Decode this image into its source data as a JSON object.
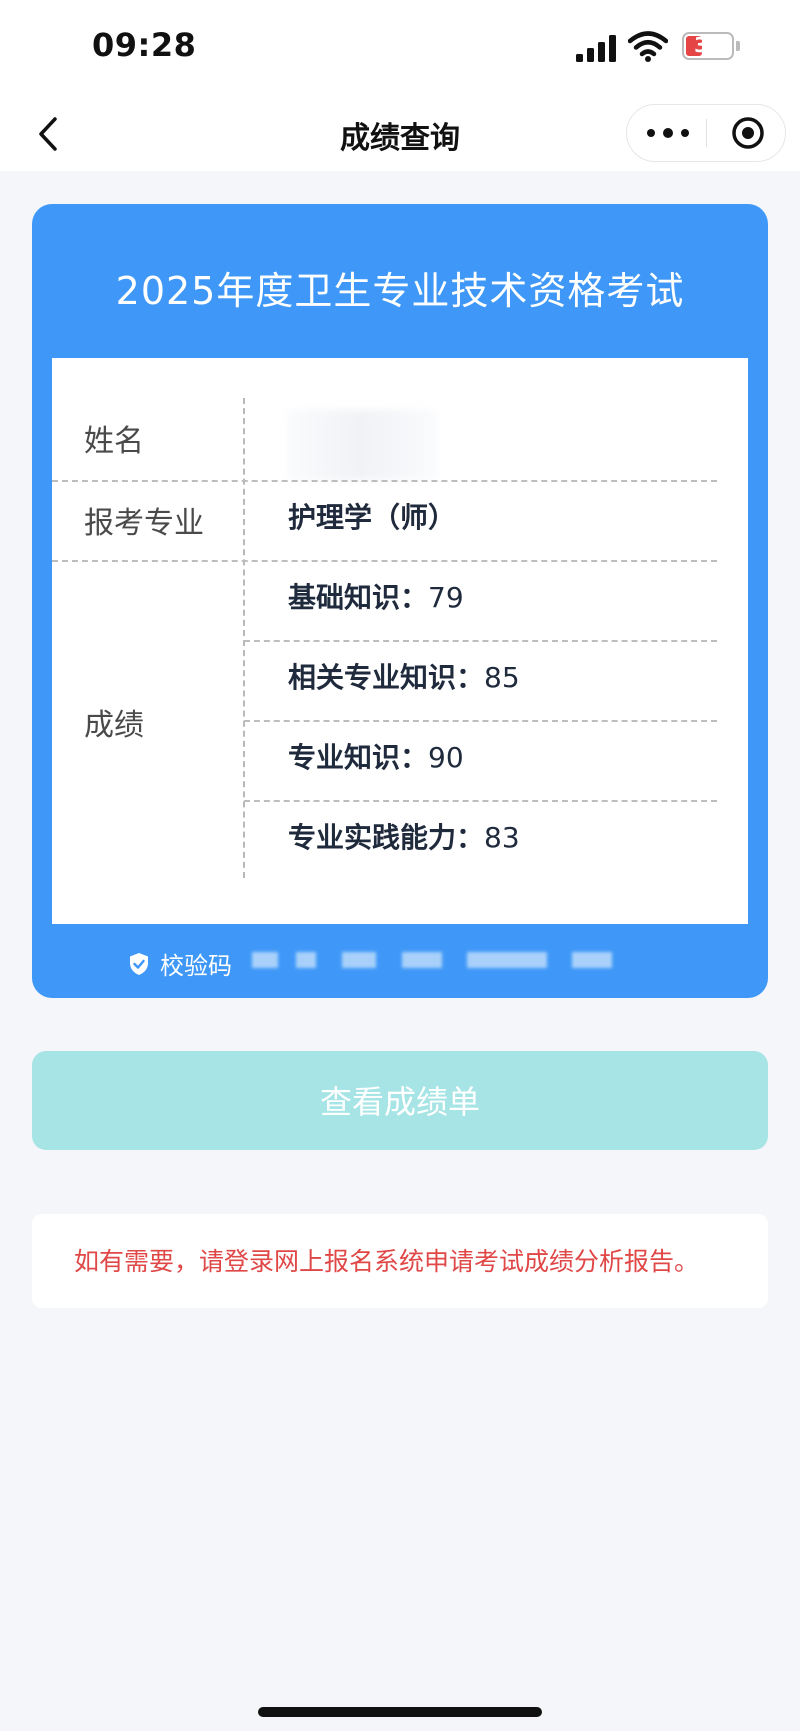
{
  "status_bar": {
    "time": "09:28",
    "battery": "34",
    "battery_level": 0.34,
    "icons": [
      "signal-icon",
      "wifi-icon",
      "battery-icon"
    ]
  },
  "nav": {
    "title": "成绩查询",
    "icons": [
      "chevron-left-icon",
      "more-dots-icon",
      "target-icon"
    ]
  },
  "card": {
    "exam_title": "2025年度卫生专业技术资格考试",
    "name_label": "姓名",
    "name_value": "",
    "major_label": "报考专业",
    "major_value": "护理学（师）",
    "score_label": "成绩",
    "scores": [
      {
        "subject": "基础知识：",
        "score": "79"
      },
      {
        "subject": "相关专业知识：",
        "score": "85"
      },
      {
        "subject": "专业知识：",
        "score": "90"
      },
      {
        "subject": "专业实践能力：",
        "score": "83"
      }
    ],
    "verify_label": "校验码",
    "verify_icon": "shield-check-icon"
  },
  "button": {
    "label": "查看成绩单"
  },
  "notice": {
    "text": "如有需要，请登录网上报名系统申请考试成绩分析报告。"
  },
  "colors": {
    "card_blue": "#3f98f7",
    "button_teal": "#a7e4e5",
    "notice_red": "#e04848",
    "page_bg": "#f4f6fa"
  }
}
